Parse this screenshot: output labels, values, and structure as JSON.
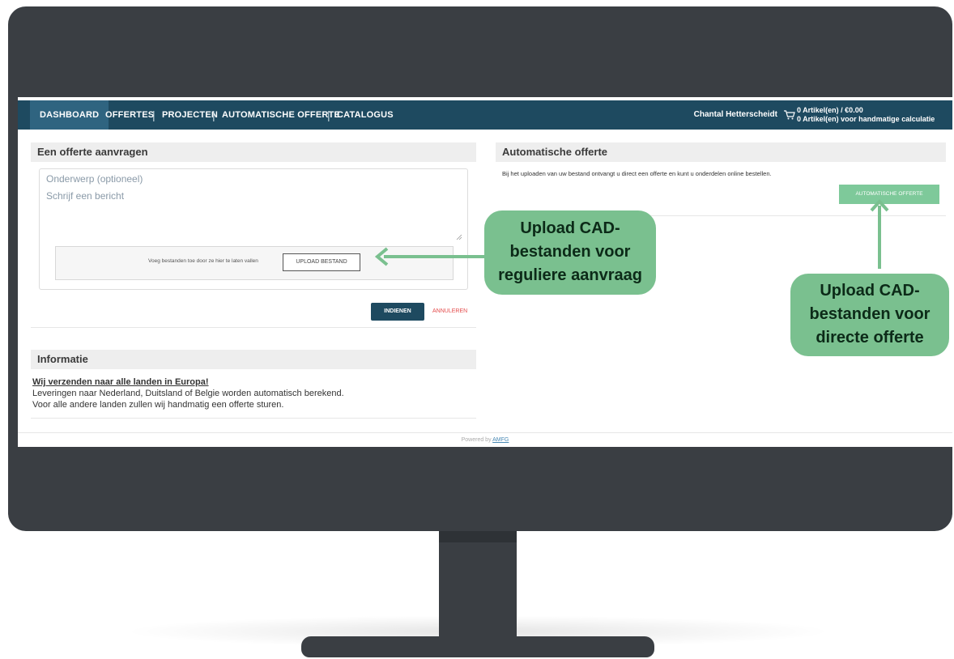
{
  "navbar": {
    "items": [
      "DASHBOARD",
      "OFFERTES",
      "PROJECTEN",
      "AUTOMATISCHE OFFERTE",
      "CATALOGUS"
    ],
    "separator": "|",
    "user_name": "Chantal Hetterscheidt",
    "cart_line1": "0 Artikel(en) / €0.00",
    "cart_line2": "0 Artikel(en) voor handmatige calculatie"
  },
  "request_panel": {
    "title": "Een offerte aanvragen",
    "subject_placeholder": "Onderwerp (optioneel)",
    "message_placeholder": "Schrijf een bericht",
    "drop_text": "Voeg bestanden toe door ze hier te laten vallen",
    "upload_button": "UPLOAD BESTAND",
    "submit_button": "INDIENEN",
    "cancel_button": "ANNULEREN"
  },
  "info_panel": {
    "title": "Informatie",
    "headline": "Wij verzenden naar alle landen in Europa!",
    "line1": "Leveringen naar Nederland, Duitsland of Belgie worden automatisch berekend.",
    "line2": "Voor alle andere landen zullen wij handmatig een offerte sturen."
  },
  "auto_panel": {
    "title": "Automatische offerte",
    "description": "Bij het uploaden van uw bestand ontvangt u direct een offerte en kunt u onderdelen online bestellen.",
    "button": "AUTOMATISCHE OFFERTE"
  },
  "footer": {
    "powered_by": "Powered by",
    "brand": "AMFG"
  },
  "annotations": {
    "regular": "Upload CAD-\nbestanden voor\nreguliere aanvraag",
    "direct": "Upload CAD-\nbestanden voor\ndirecte offerte"
  },
  "colors": {
    "navbar": "#1e4a60",
    "accent_green": "#7ac08f",
    "cancel_red": "#e44c4c",
    "monitor": "#3a3e43"
  },
  "icons": [
    "cart-icon",
    "arrow-left-icon",
    "arrow-up-icon"
  ]
}
